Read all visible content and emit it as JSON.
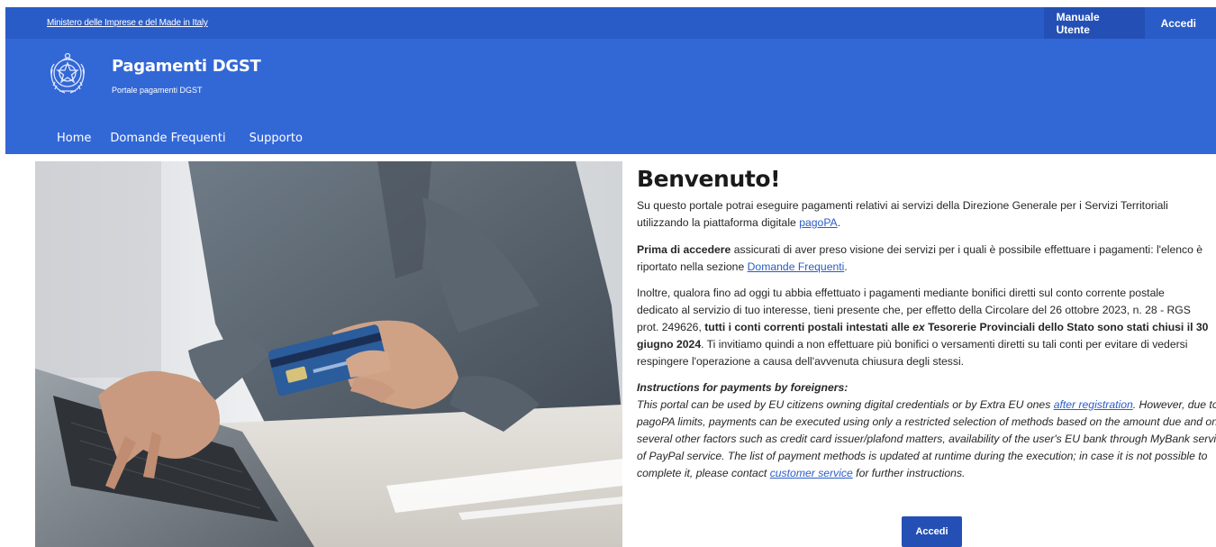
{
  "top_bar": {
    "ministry_link": "Ministero delle Imprese e del Made in Italy",
    "manual_label": "Manuale Utente",
    "login_label": "Accedi"
  },
  "brand": {
    "title": "Pagamenti DGST",
    "subtitle": "Portale pagamenti DGST",
    "emblem_icon": "italian-republic-emblem-icon"
  },
  "nav": {
    "items": [
      "Home",
      "Domande Frequenti",
      "Supporto"
    ]
  },
  "main": {
    "heading": "Benvenuto!",
    "intro": {
      "line1": "Su questo portale potrai eseguire pagamenti relativi ai servizi della Direzione Generale per i Servizi Territoriali",
      "line2_pre": "utilizzando la piattaforma digitale ",
      "line2_link": "pagoPA",
      "line2_post": "."
    },
    "before_access": {
      "bold": "Prima di accedere",
      "line1_rest": " assicurati di aver preso visione dei servizi per i quali è possibile effettuare i pagamenti: l'elenco è",
      "line2_pre": "riportato nella sezione ",
      "line2_link": "Domande Frequenti",
      "line2_post": "."
    },
    "notice": {
      "line1": "Inoltre, qualora fino ad oggi tu abbia effettuato i pagamenti mediante bonifici diretti sul conto corrente postale",
      "line2": "dedicato al servizio di tuo interesse, tieni presente che, per effetto della Circolare del 26 ottobre 2023, n. 28 - RGS",
      "line3_pre": "prot. 249626, ",
      "line3_bold_a": "tutti i conti correnti postali intestati alle ",
      "line3_bold_italic": "ex",
      "line3_bold_b": " Tesorerie Provinciali dello Stato sono stati chiusi il 30",
      "line4_bold": "giugno 2024",
      "line4_rest": ". Ti invitiamo quindi a non effettuare più bonifici o versamenti diretti su tali conti per evitare di vedersi",
      "line5": "respingere l'operazione a causa dell'avvenuta chiusura degli stessi."
    },
    "foreigners": {
      "heading": "Instructions for payments by foreigners:",
      "line1_pre": "This portal can be used by EU citizens owning digital credentials or by Extra EU ones ",
      "line1_link": "after registration",
      "line1_post": ".  However, due to",
      "line2": "pagoPA limits, payments can be executed using only a restricted selection of methods based on the amount due and on",
      "line3": "several other factors such as credit card issuer/plafond matters, availability of the user's EU bank through MyBank service or",
      "line4": "of PayPal service. The list of payment methods is updated at runtime during the execution; in case it is not possible to",
      "line5_pre": "complete it, please contact ",
      "line5_link": "customer service",
      "line5_post": " for further instructions."
    },
    "login_button": "Accedi"
  },
  "colors": {
    "top_bar": "#2a5cc8",
    "header": "#3267d6",
    "button": "#2450b5",
    "link": "#2a5cc8"
  }
}
